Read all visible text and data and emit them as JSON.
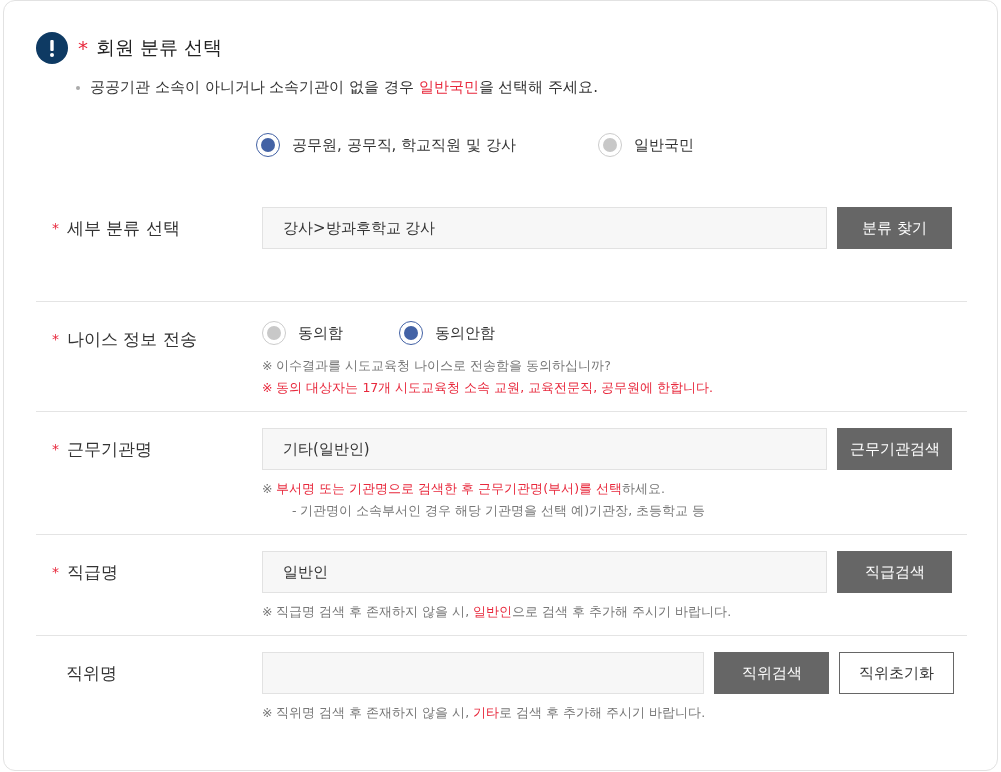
{
  "header": {
    "title": "회원 분류 선택",
    "required_mark": "*"
  },
  "notice": [
    {
      "text": "공공기관 소속이 아니거나 소속기관이 없을 경우 ",
      "highlight": false
    },
    {
      "text": "일반국민",
      "highlight": true
    },
    {
      "text": "을 선택해 주세요.",
      "highlight": false
    }
  ],
  "member_types": [
    {
      "label": "공무원, 공무직, 학교직원 및 강사",
      "selected": true
    },
    {
      "label": "일반국민",
      "selected": false
    }
  ],
  "rows": [
    {
      "kind": "input",
      "label": "세부 분류 선택",
      "required_mark": "*",
      "value": "강사>방과후학교 강사",
      "buttons": [
        {
          "label": "분류 찾기",
          "kind": "primary"
        }
      ],
      "notes": []
    },
    {
      "kind": "radios",
      "label": "나이스 정보 전송",
      "required_mark": "*",
      "options": [
        {
          "label": "동의함",
          "selected": false
        },
        {
          "label": "동의안함",
          "selected": true
        }
      ],
      "notes": [
        {
          "indent": false,
          "segments": [
            {
              "text": "※ 이수결과를 시도교육청 나이스로 전송함을 동의하십니까?",
              "highlight": false
            }
          ]
        },
        {
          "indent": false,
          "segments": [
            {
              "text": "※ 동의 대상자는 17개 시도교육청 소속 교원, 교육전문직, 공무원에 한합니다.",
              "highlight": true
            }
          ]
        }
      ]
    },
    {
      "kind": "input",
      "label": "근무기관명",
      "required_mark": "*",
      "value": "기타(일반인)",
      "buttons": [
        {
          "label": "근무기관검색",
          "kind": "primary"
        }
      ],
      "notes": [
        {
          "indent": false,
          "segments": [
            {
              "text": "※ ",
              "highlight": false
            },
            {
              "text": "부서명 또는 기관명으로 검색한 후 근무기관명(부서)를 선택",
              "highlight": true
            },
            {
              "text": "하세요.",
              "highlight": false
            }
          ]
        },
        {
          "indent": true,
          "segments": [
            {
              "text": "- 기관명이 소속부서인 경우 해당 기관명을 선택 예)기관장, 초등학교 등",
              "highlight": false
            }
          ]
        }
      ]
    },
    {
      "kind": "input",
      "label": "직급명",
      "required_mark": "*",
      "value": "일반인",
      "buttons": [
        {
          "label": "직급검색",
          "kind": "primary"
        }
      ],
      "notes": [
        {
          "indent": false,
          "segments": [
            {
              "text": "※ 직급명 검색 후 존재하지 않을 시, ",
              "highlight": false
            },
            {
              "text": "일반인",
              "highlight": true
            },
            {
              "text": "으로 검색 후 추가해 주시기 바랍니다.",
              "highlight": false
            }
          ]
        }
      ]
    },
    {
      "kind": "input",
      "label": "직위명",
      "buttons": [
        {
          "label": "직위검색",
          "kind": "primary"
        },
        {
          "label": "직위초기화",
          "kind": "outline"
        }
      ],
      "notes": [
        {
          "indent": false,
          "segments": [
            {
              "text": "※ 직위명 검색 후 존재하지 않을 시, ",
              "highlight": false
            },
            {
              "text": "기타",
              "highlight": true
            },
            {
              "text": "로 검색 후 추가해 주시기 바랍니다.",
              "highlight": false
            }
          ]
        }
      ]
    }
  ]
}
